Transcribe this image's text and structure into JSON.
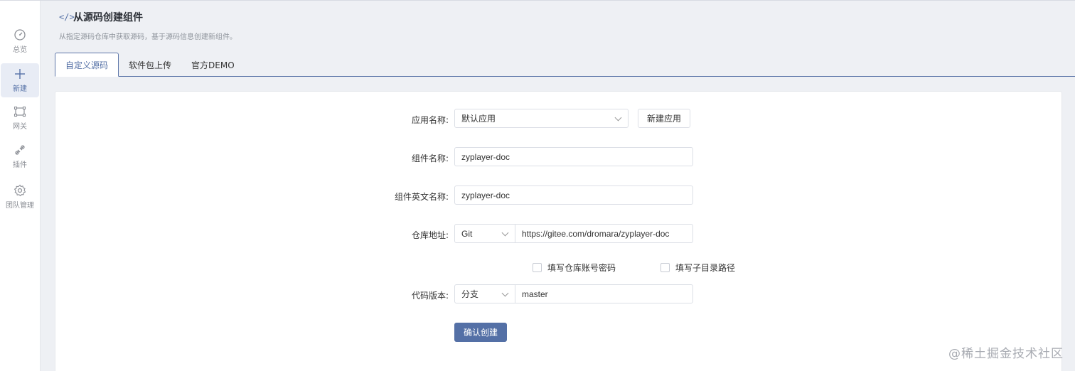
{
  "sidebar": {
    "items": [
      {
        "label": "总览",
        "icon": "dashboard-icon"
      },
      {
        "label": "新建",
        "icon": "plus-icon"
      },
      {
        "label": "网关",
        "icon": "gateway-icon"
      },
      {
        "label": "插件",
        "icon": "plugin-icon"
      },
      {
        "label": "团队管理",
        "icon": "gear-icon"
      }
    ]
  },
  "header": {
    "title": "从源码创建组件",
    "subtitle": "从指定源码仓库中获取源码，基于源码信息创建新组件。"
  },
  "tabs": [
    {
      "label": "自定义源码"
    },
    {
      "label": "软件包上传"
    },
    {
      "label": "官方DEMO"
    }
  ],
  "form": {
    "app_name": {
      "label": "应用名称:",
      "value": "默认应用",
      "new_button": "新建应用"
    },
    "component_name": {
      "label": "组件名称:",
      "value": "zyplayer-doc"
    },
    "component_en_name": {
      "label": "组件英文名称:",
      "value": "zyplayer-doc"
    },
    "repo": {
      "label": "仓库地址:",
      "type": "Git",
      "url": "https://gitee.com/dromara/zyplayer-doc"
    },
    "checks": {
      "credentials": "填写仓库账号密码",
      "subdir": "填写子目录路径"
    },
    "version": {
      "label": "代码版本:",
      "type": "分支",
      "value": "master"
    },
    "submit": "确认创建"
  },
  "watermark": "@稀土掘金技术社区",
  "colors": {
    "accent": "#5470a6"
  }
}
